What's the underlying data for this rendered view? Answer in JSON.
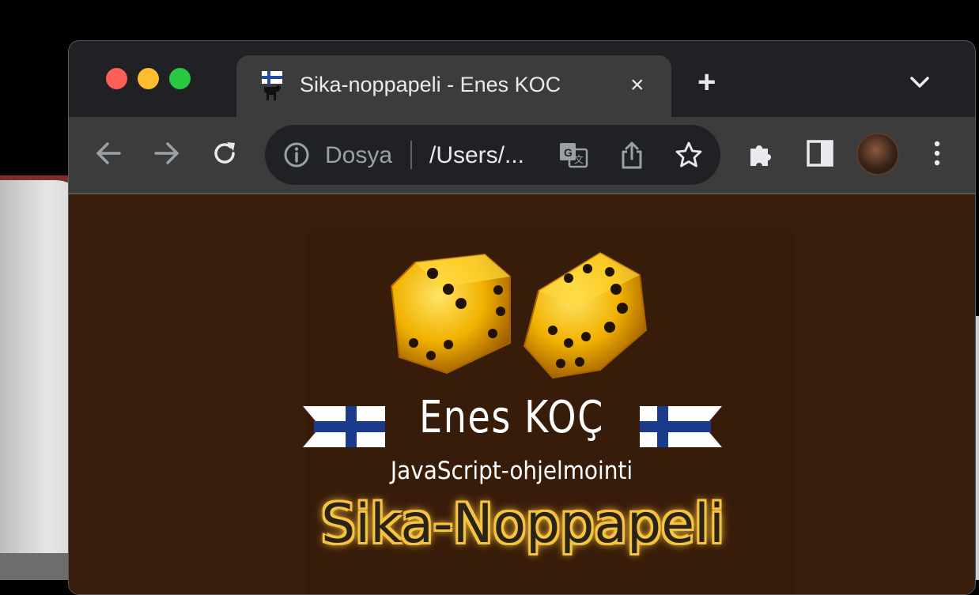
{
  "window": {
    "traffic_lights": {
      "close_color": "#fe5f57",
      "minimize_color": "#febc2e",
      "maximize_color": "#28c840"
    }
  },
  "tab": {
    "title": "Sika-noppapeli - Enes KOC",
    "close_glyph": "×",
    "favicon": "finnish-lion-icon"
  },
  "tabbar": {
    "new_tab_glyph": "+",
    "tab_menu_icon": "chevron-down-icon"
  },
  "toolbar": {
    "back_icon": "arrow-left-icon",
    "forward_icon": "arrow-right-icon",
    "reload_icon": "reload-icon",
    "extensions_icon": "puzzle-icon",
    "side_panel_icon": "side-panel-icon",
    "menu_icon": "kebab-menu-icon"
  },
  "omnibox": {
    "scheme_label": "Dosya",
    "url": "/Users/...",
    "info_icon": "info-icon",
    "translate_icon": "translate-icon",
    "share_icon": "share-icon",
    "bookmark_icon": "star-icon"
  },
  "page": {
    "author_name": "Enes KOÇ",
    "subtitle": "JavaScript-ohjelmointi",
    "game_title": "Sika-Noppapeli",
    "background_color": "#3a1e0c",
    "title_glow_color": "#f6c443"
  }
}
